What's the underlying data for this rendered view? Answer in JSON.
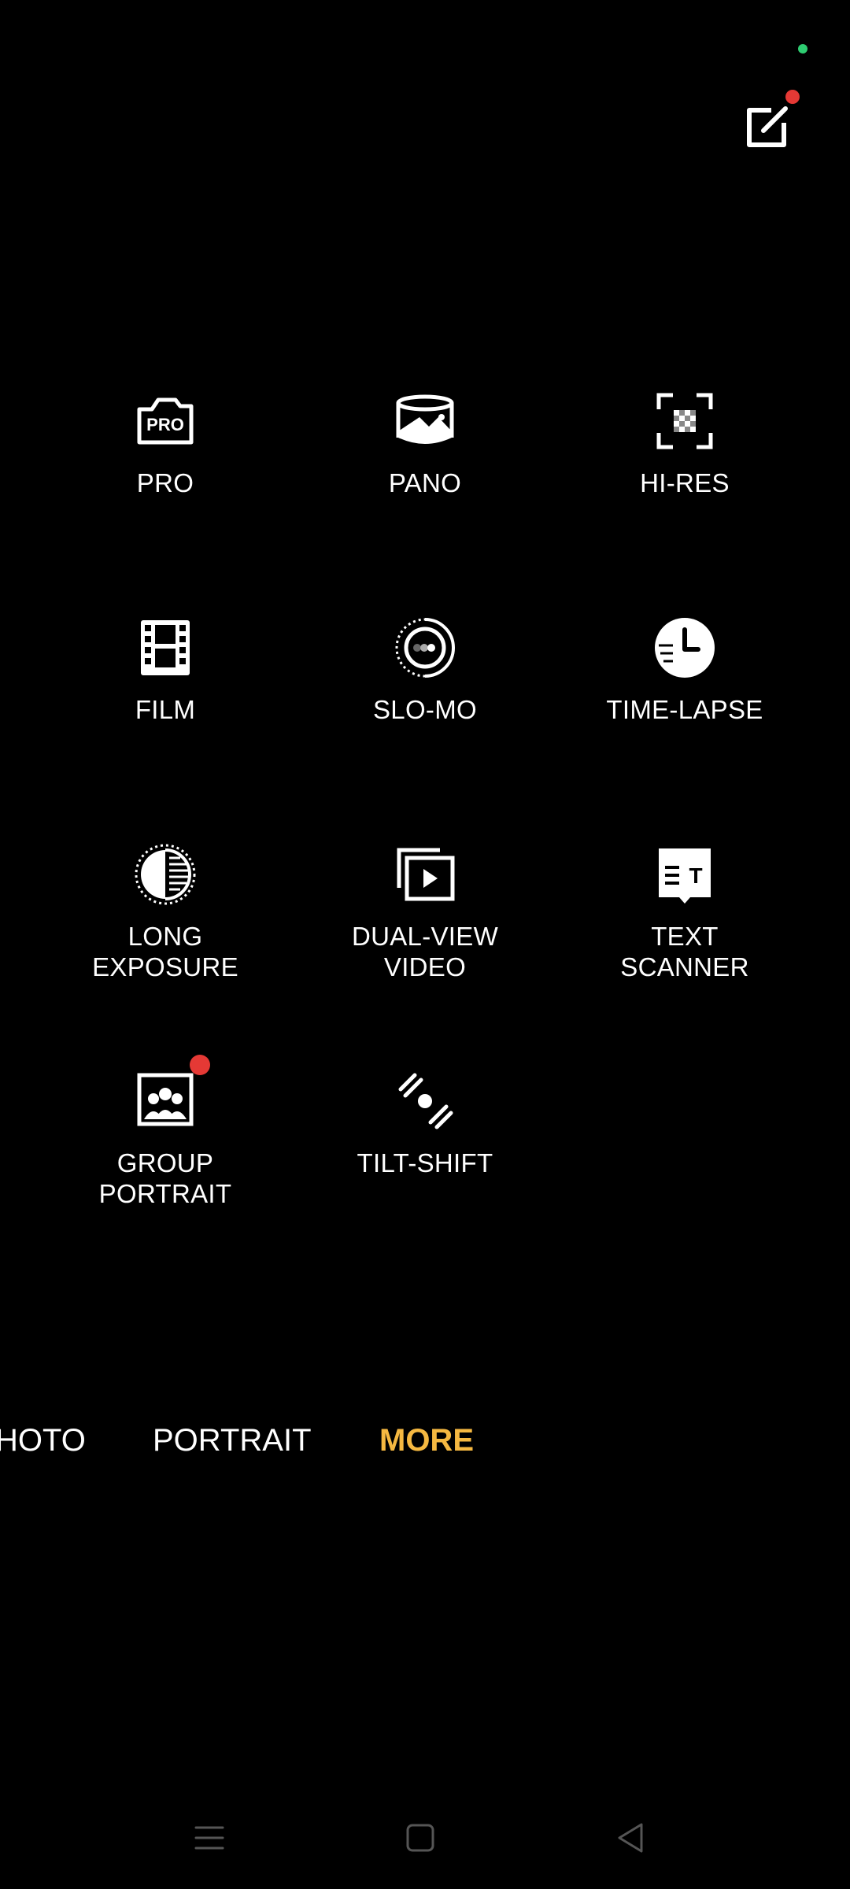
{
  "top": {
    "edit_icon": "edit-icon"
  },
  "modes": [
    {
      "label": "PRO",
      "icon": "pro-camera-icon"
    },
    {
      "label": "PANO",
      "icon": "panorama-icon"
    },
    {
      "label": "HI-RES",
      "icon": "hi-res-icon"
    },
    {
      "label": "FILM",
      "icon": "film-icon"
    },
    {
      "label": "SLO-MO",
      "icon": "slow-motion-icon"
    },
    {
      "label": "TIME-LAPSE",
      "icon": "time-lapse-icon"
    },
    {
      "label": "LONG\nEXPOSURE",
      "icon": "long-exposure-icon"
    },
    {
      "label": "DUAL-VIEW\nVIDEO",
      "icon": "dual-view-video-icon"
    },
    {
      "label": "TEXT\nSCANNER",
      "icon": "text-scanner-icon"
    },
    {
      "label": "GROUP\nPORTRAIT",
      "icon": "group-portrait-icon"
    },
    {
      "label": "TILT-SHIFT",
      "icon": "tilt-shift-icon"
    }
  ],
  "mode_bar": {
    "tabs": [
      "HOTO",
      "PORTRAIT",
      "MORE"
    ],
    "active": "MORE"
  },
  "nav": {
    "menu_icon": "recents-icon",
    "home_icon": "home-icon",
    "back_icon": "back-icon"
  },
  "colors": {
    "accent": "#f5b841",
    "badge": "#e53935",
    "privacy_dot": "#2ecc71",
    "background": "#000000"
  }
}
